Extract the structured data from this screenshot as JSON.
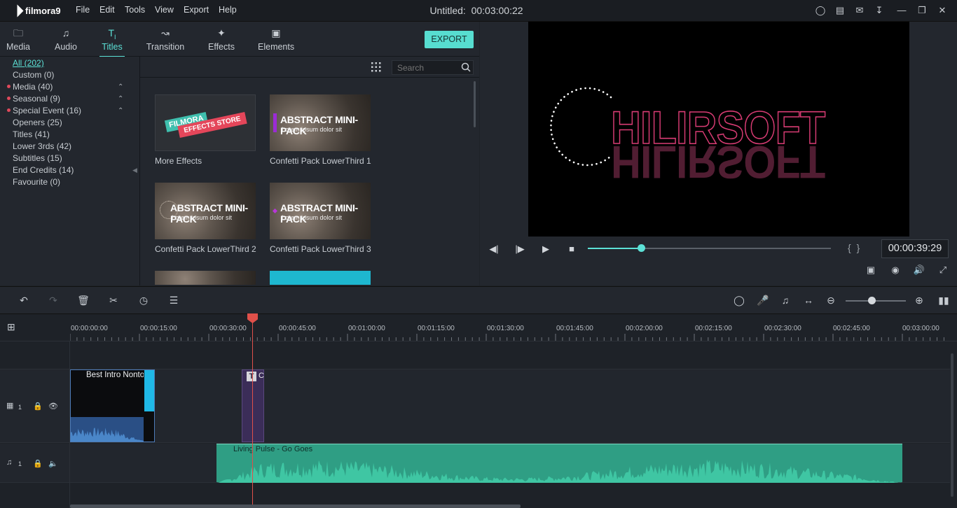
{
  "app": {
    "name": "filmora9",
    "title": "Untitled:",
    "duration": "00:03:00:22"
  },
  "menu": [
    "File",
    "Edit",
    "Tools",
    "View",
    "Export",
    "Help"
  ],
  "tabs": [
    {
      "label": "Media",
      "icon": "folder-icon"
    },
    {
      "label": "Audio",
      "icon": "music-note-icon"
    },
    {
      "label": "Titles",
      "icon": "text-icon"
    },
    {
      "label": "Transition",
      "icon": "transition-icon"
    },
    {
      "label": "Effects",
      "icon": "effects-icon"
    },
    {
      "label": "Elements",
      "icon": "image-icon"
    }
  ],
  "export_label": "EXPORT",
  "categories": [
    {
      "label": "All (202)"
    },
    {
      "label": "Custom (0)"
    },
    {
      "label": "Media (40)"
    },
    {
      "label": "Seasonal (9)"
    },
    {
      "label": "Special Event (16)"
    },
    {
      "label": "Openers (25)"
    },
    {
      "label": "Titles (41)"
    },
    {
      "label": "Lower 3rds (42)"
    },
    {
      "label": "Subtitles (15)"
    },
    {
      "label": "End Credits (14)"
    },
    {
      "label": "Favourite (0)"
    }
  ],
  "search": {
    "placeholder": "Search"
  },
  "thumbnails": [
    {
      "label": "More Effects",
      "line1": "FILMORA",
      "line2": "EFFECTS STORE"
    },
    {
      "label": "Confetti Pack LowerThird 1",
      "title": "ABSTRACT MINI-PACK",
      "sub": "Lorem ipsum dolor sit"
    },
    {
      "label": "Confetti Pack LowerThird 2",
      "title": "ABSTRACT MINI-PACK",
      "sub": "Lorem ipsum dolor sit"
    },
    {
      "label": "Confetti Pack LowerThird 3",
      "title": "ABSTRACT MINI-PACK",
      "sub": "Lorem ipsum dolor sit"
    }
  ],
  "preview": {
    "text": "HILIRSOFT",
    "timecode": "00:00:39:29",
    "progress": 0.22
  },
  "ruler": [
    "00:00:00:00",
    "00:00:15:00",
    "00:00:30:00",
    "00:00:45:00",
    "00:01:00:00",
    "00:01:15:00",
    "00:01:30:00",
    "00:01:45:00",
    "00:02:00:00",
    "00:02:15:00",
    "00:02:30:00",
    "00:02:45:00",
    "00:03:00:00"
  ],
  "tracks": {
    "video": {
      "num": "1",
      "clip": "Best Intro Nonto",
      "title_clip": "C"
    },
    "audio": {
      "num": "1",
      "clip": "Living Pulse - Go Goes"
    }
  },
  "colors": {
    "accent": "#5ce1d6",
    "playhead": "#e0504a",
    "audio": "#2f9e84"
  }
}
